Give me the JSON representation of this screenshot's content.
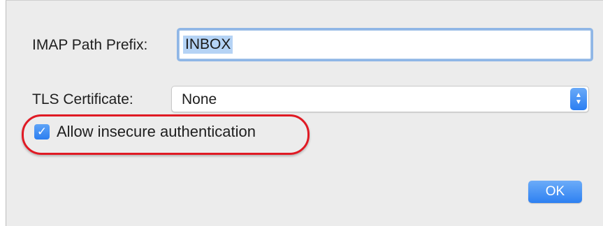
{
  "form": {
    "imap_path_prefix": {
      "label": "IMAP Path Prefix:",
      "value": "INBOX"
    },
    "tls_certificate": {
      "label": "TLS Certificate:",
      "selected": "None",
      "stepper_up": "▲",
      "stepper_down": "▼"
    },
    "allow_insecure_auth": {
      "label": "Allow insecure authentication",
      "checked": true,
      "check_glyph": "✓"
    }
  },
  "buttons": {
    "ok_label": "OK"
  },
  "annotation": {
    "highlight_color": "#e01a24"
  },
  "colors": {
    "accent": "#2d80f2",
    "selection": "#b5d3f5",
    "dialog_bg": "#ececec"
  }
}
